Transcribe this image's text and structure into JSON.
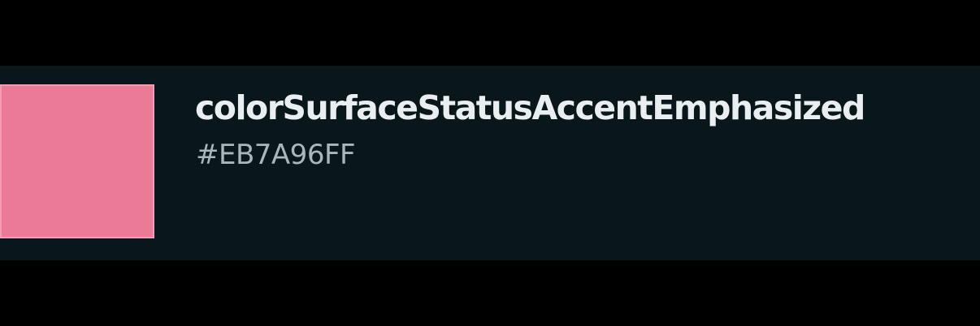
{
  "token": {
    "name": "colorSurfaceStatusAccentEmphasized",
    "value": "#EB7A96FF",
    "swatch_color": "#EB7A96"
  },
  "colors": {
    "page_background": "#000000",
    "card_background": "#0A171A",
    "name_text": "#E9EEF0",
    "value_text": "#AAB6BA"
  }
}
